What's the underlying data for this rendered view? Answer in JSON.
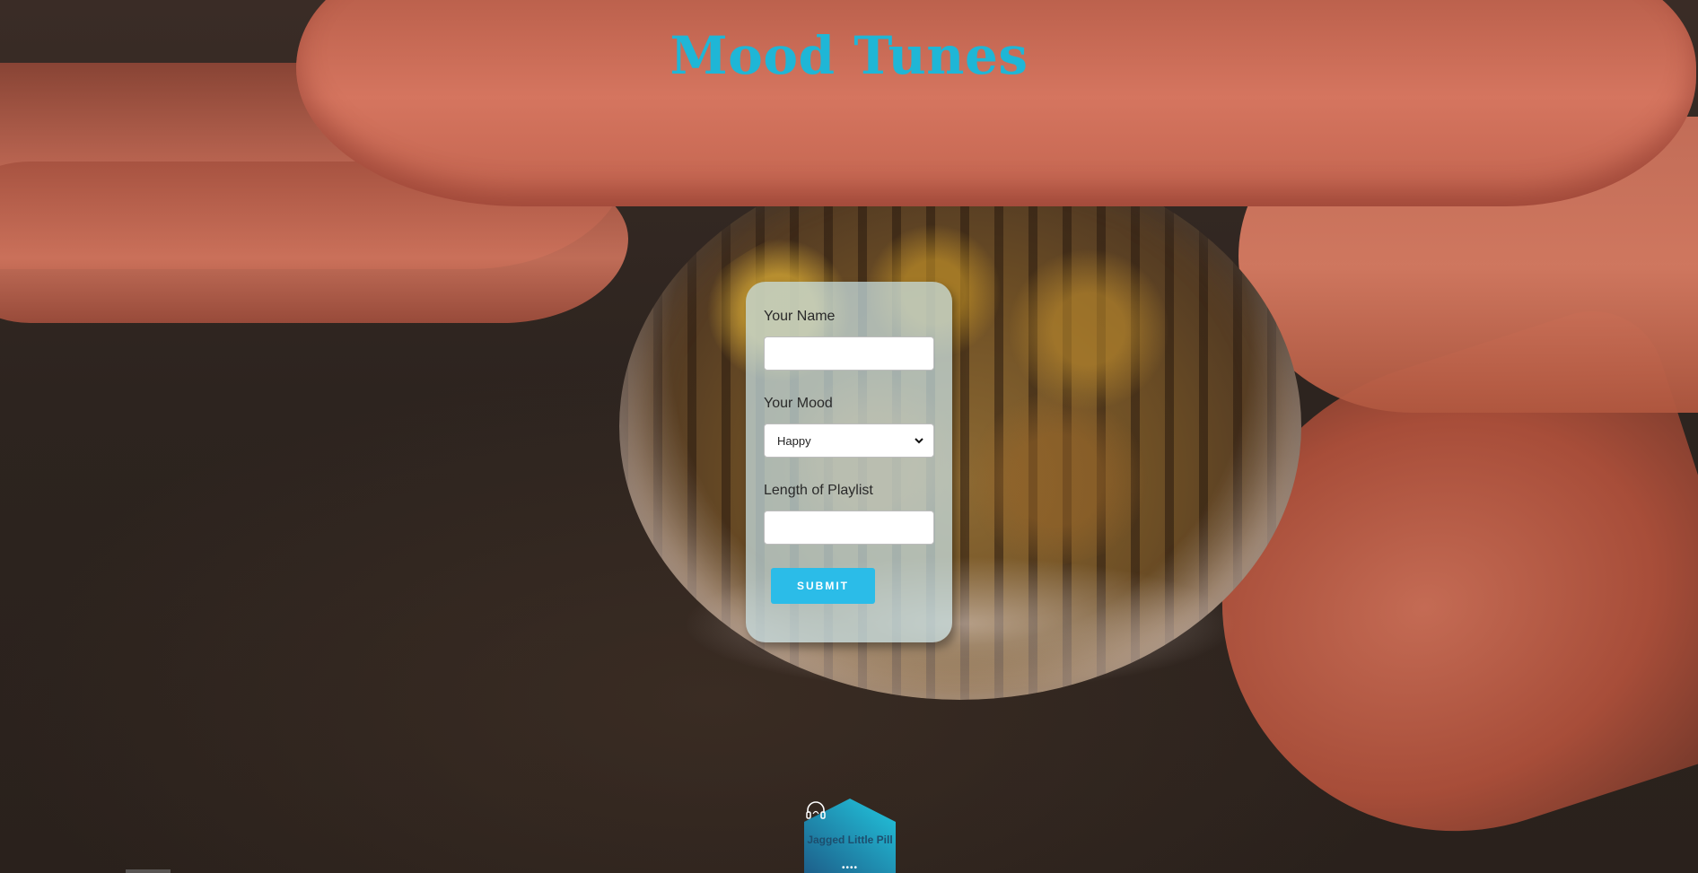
{
  "header": {
    "title": "Mood Tunes"
  },
  "form": {
    "name_label": "Your Name",
    "name_value": "",
    "mood_label": "Your Mood",
    "mood_selected": "Happy",
    "length_label": "Length of Playlist",
    "length_value": "",
    "submit_label": "SUBMIT"
  },
  "badge": {
    "icon": "headphones-icon",
    "text": "Jagged Little Pill",
    "dots": "••••"
  },
  "colors": {
    "title": "#1fb6d6",
    "submit_button": "#2bbce8",
    "card_background": "#c8e1e4",
    "badge_gradient_start": "#1d5f8a",
    "badge_gradient_end": "#22c7df"
  }
}
